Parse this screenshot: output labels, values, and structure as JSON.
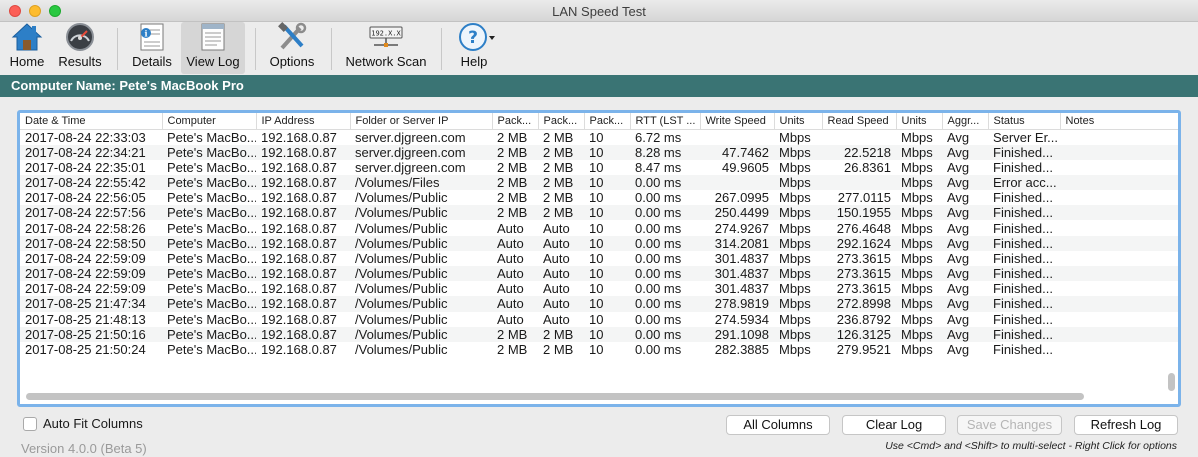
{
  "window": {
    "title": "LAN Speed Test"
  },
  "toolbar": {
    "home": "Home",
    "results": "Results",
    "details": "Details",
    "view_log": "View Log",
    "options": "Options",
    "network_scan": "Network Scan",
    "network_scan_icon_text": "192.X.X",
    "help": "Help"
  },
  "computer_name": "Computer Name: Pete's MacBook Pro",
  "table": {
    "columns": [
      "Date & Time",
      "Computer",
      "IP Address",
      "Folder or Server IP",
      "Pack...",
      "Pack...",
      "Pack...",
      "RTT (LST ...",
      "Write Speed",
      "Units",
      "Read Speed",
      "Units",
      "Aggr...",
      "Status",
      "Notes"
    ],
    "rows": [
      [
        "2017-08-24 22:33:03",
        "Pete's MacBo...",
        "192.168.0.87",
        "server.djgreen.com",
        "2 MB",
        "2 MB",
        "10",
        "6.72 ms",
        "",
        "Mbps",
        "",
        "Mbps",
        "Avg",
        "Server Er...",
        ""
      ],
      [
        "2017-08-24 22:34:21",
        "Pete's MacBo...",
        "192.168.0.87",
        "server.djgreen.com",
        "2 MB",
        "2 MB",
        "10",
        "8.28 ms",
        "47.7462",
        "Mbps",
        "22.5218",
        "Mbps",
        "Avg",
        "Finished...",
        ""
      ],
      [
        "2017-08-24 22:35:01",
        "Pete's MacBo...",
        "192.168.0.87",
        "server.djgreen.com",
        "2 MB",
        "2 MB",
        "10",
        "8.47 ms",
        "49.9605",
        "Mbps",
        "26.8361",
        "Mbps",
        "Avg",
        "Finished...",
        ""
      ],
      [
        "2017-08-24 22:55:42",
        "Pete's MacBo...",
        "192.168.0.87",
        "/Volumes/Files",
        "2 MB",
        "2 MB",
        "10",
        "0.00 ms",
        "",
        "Mbps",
        "",
        "Mbps",
        "Avg",
        "Error acc...",
        ""
      ],
      [
        "2017-08-24 22:56:05",
        "Pete's MacBo...",
        "192.168.0.87",
        "/Volumes/Public",
        "2 MB",
        "2 MB",
        "10",
        "0.00 ms",
        "267.0995",
        "Mbps",
        "277.0115",
        "Mbps",
        "Avg",
        "Finished...",
        ""
      ],
      [
        "2017-08-24 22:57:56",
        "Pete's MacBo...",
        "192.168.0.87",
        "/Volumes/Public",
        "2 MB",
        "2 MB",
        "10",
        "0.00 ms",
        "250.4499",
        "Mbps",
        "150.1955",
        "Mbps",
        "Avg",
        "Finished...",
        ""
      ],
      [
        "2017-08-24 22:58:26",
        "Pete's MacBo...",
        "192.168.0.87",
        "/Volumes/Public",
        "Auto",
        "Auto",
        "10",
        "0.00 ms",
        "274.9267",
        "Mbps",
        "276.4648",
        "Mbps",
        "Avg",
        "Finished...",
        ""
      ],
      [
        "2017-08-24 22:58:50",
        "Pete's MacBo...",
        "192.168.0.87",
        "/Volumes/Public",
        "Auto",
        "Auto",
        "10",
        "0.00 ms",
        "314.2081",
        "Mbps",
        "292.1624",
        "Mbps",
        "Avg",
        "Finished...",
        ""
      ],
      [
        "2017-08-24 22:59:09",
        "Pete's MacBo...",
        "192.168.0.87",
        "/Volumes/Public",
        "Auto",
        "Auto",
        "10",
        "0.00 ms",
        "301.4837",
        "Mbps",
        "273.3615",
        "Mbps",
        "Avg",
        "Finished...",
        ""
      ],
      [
        "2017-08-24 22:59:09",
        "Pete's MacBo...",
        "192.168.0.87",
        "/Volumes/Public",
        "Auto",
        "Auto",
        "10",
        "0.00 ms",
        "301.4837",
        "Mbps",
        "273.3615",
        "Mbps",
        "Avg",
        "Finished...",
        ""
      ],
      [
        "2017-08-24 22:59:09",
        "Pete's MacBo...",
        "192.168.0.87",
        "/Volumes/Public",
        "Auto",
        "Auto",
        "10",
        "0.00 ms",
        "301.4837",
        "Mbps",
        "273.3615",
        "Mbps",
        "Avg",
        "Finished...",
        ""
      ],
      [
        "2017-08-25 21:47:34",
        "Pete's MacBo...",
        "192.168.0.87",
        "/Volumes/Public",
        "Auto",
        "Auto",
        "10",
        "0.00 ms",
        "278.9819",
        "Mbps",
        "272.8998",
        "Mbps",
        "Avg",
        "Finished...",
        ""
      ],
      [
        "2017-08-25 21:48:13",
        "Pete's MacBo...",
        "192.168.0.87",
        "/Volumes/Public",
        "Auto",
        "Auto",
        "10",
        "0.00 ms",
        "274.5934",
        "Mbps",
        "236.8792",
        "Mbps",
        "Avg",
        "Finished...",
        ""
      ],
      [
        "2017-08-25 21:50:16",
        "Pete's MacBo...",
        "192.168.0.87",
        "/Volumes/Public",
        "2 MB",
        "2 MB",
        "10",
        "0.00 ms",
        "291.1098",
        "Mbps",
        "126.3125",
        "Mbps",
        "Avg",
        "Finished...",
        ""
      ],
      [
        "2017-08-25 21:50:24",
        "Pete's MacBo...",
        "192.168.0.87",
        "/Volumes/Public",
        "2 MB",
        "2 MB",
        "10",
        "0.00 ms",
        "282.3885",
        "Mbps",
        "279.9521",
        "Mbps",
        "Avg",
        "Finished...",
        ""
      ]
    ]
  },
  "footer": {
    "auto_fit_label": "Auto Fit Columns",
    "auto_fit_checked": false,
    "all_columns": "All Columns",
    "clear_log": "Clear Log",
    "save_changes": "Save Changes",
    "refresh_log": "Refresh Log",
    "version": "Version 4.0.0 (Beta 5)",
    "hint": "Use <Cmd> and <Shift> to multi-select - Right Click for options"
  },
  "colors": {
    "name_bar": "#3a7474",
    "selection_border": "#7bb3ea"
  }
}
